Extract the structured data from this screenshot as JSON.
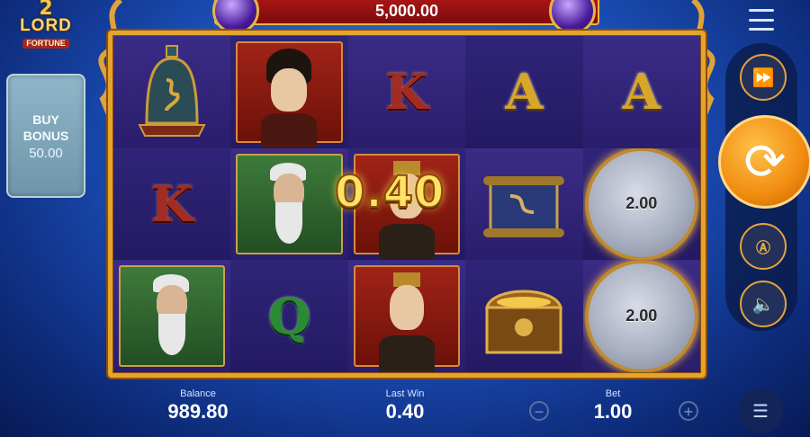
{
  "logo": {
    "number": "2",
    "title": "LORD",
    "subtitle": "FORTUNE"
  },
  "buy_bonus": {
    "label_line1": "BUY",
    "label_line2": "BONUS",
    "price": "50.00"
  },
  "jackpot": {
    "value": "5,000.00"
  },
  "reels": {
    "symbols": [
      [
        "bell",
        "K",
        "sage"
      ],
      [
        "lady",
        "sage",
        "Q"
      ],
      [
        "K",
        "lord",
        "lord"
      ],
      [
        "A",
        "scroll",
        "treasure-chest"
      ],
      [
        "A",
        "orb",
        "orb"
      ]
    ],
    "orb_values": [
      "2.00",
      "2.00"
    ]
  },
  "win_overlay": {
    "amount": "0.40"
  },
  "footer": {
    "balance_label": "Balance",
    "balance_value": "989.80",
    "lastwin_label": "Last Win",
    "lastwin_value": "0.40",
    "bet_label": "Bet",
    "bet_value": "1.00"
  },
  "icons": {
    "menu": "hamburger-icon",
    "turbo": "fast-forward-icon",
    "spin": "refresh-icon",
    "autoplay": "autoplay-icon",
    "sound": "speaker-icon",
    "coins": "coin-stack-icon",
    "minus": "minus-icon",
    "plus": "plus-icon"
  },
  "colors": {
    "accent": "#f18c10",
    "frame_gold": "#e4a52b",
    "jackpot_red": "#a81516"
  }
}
